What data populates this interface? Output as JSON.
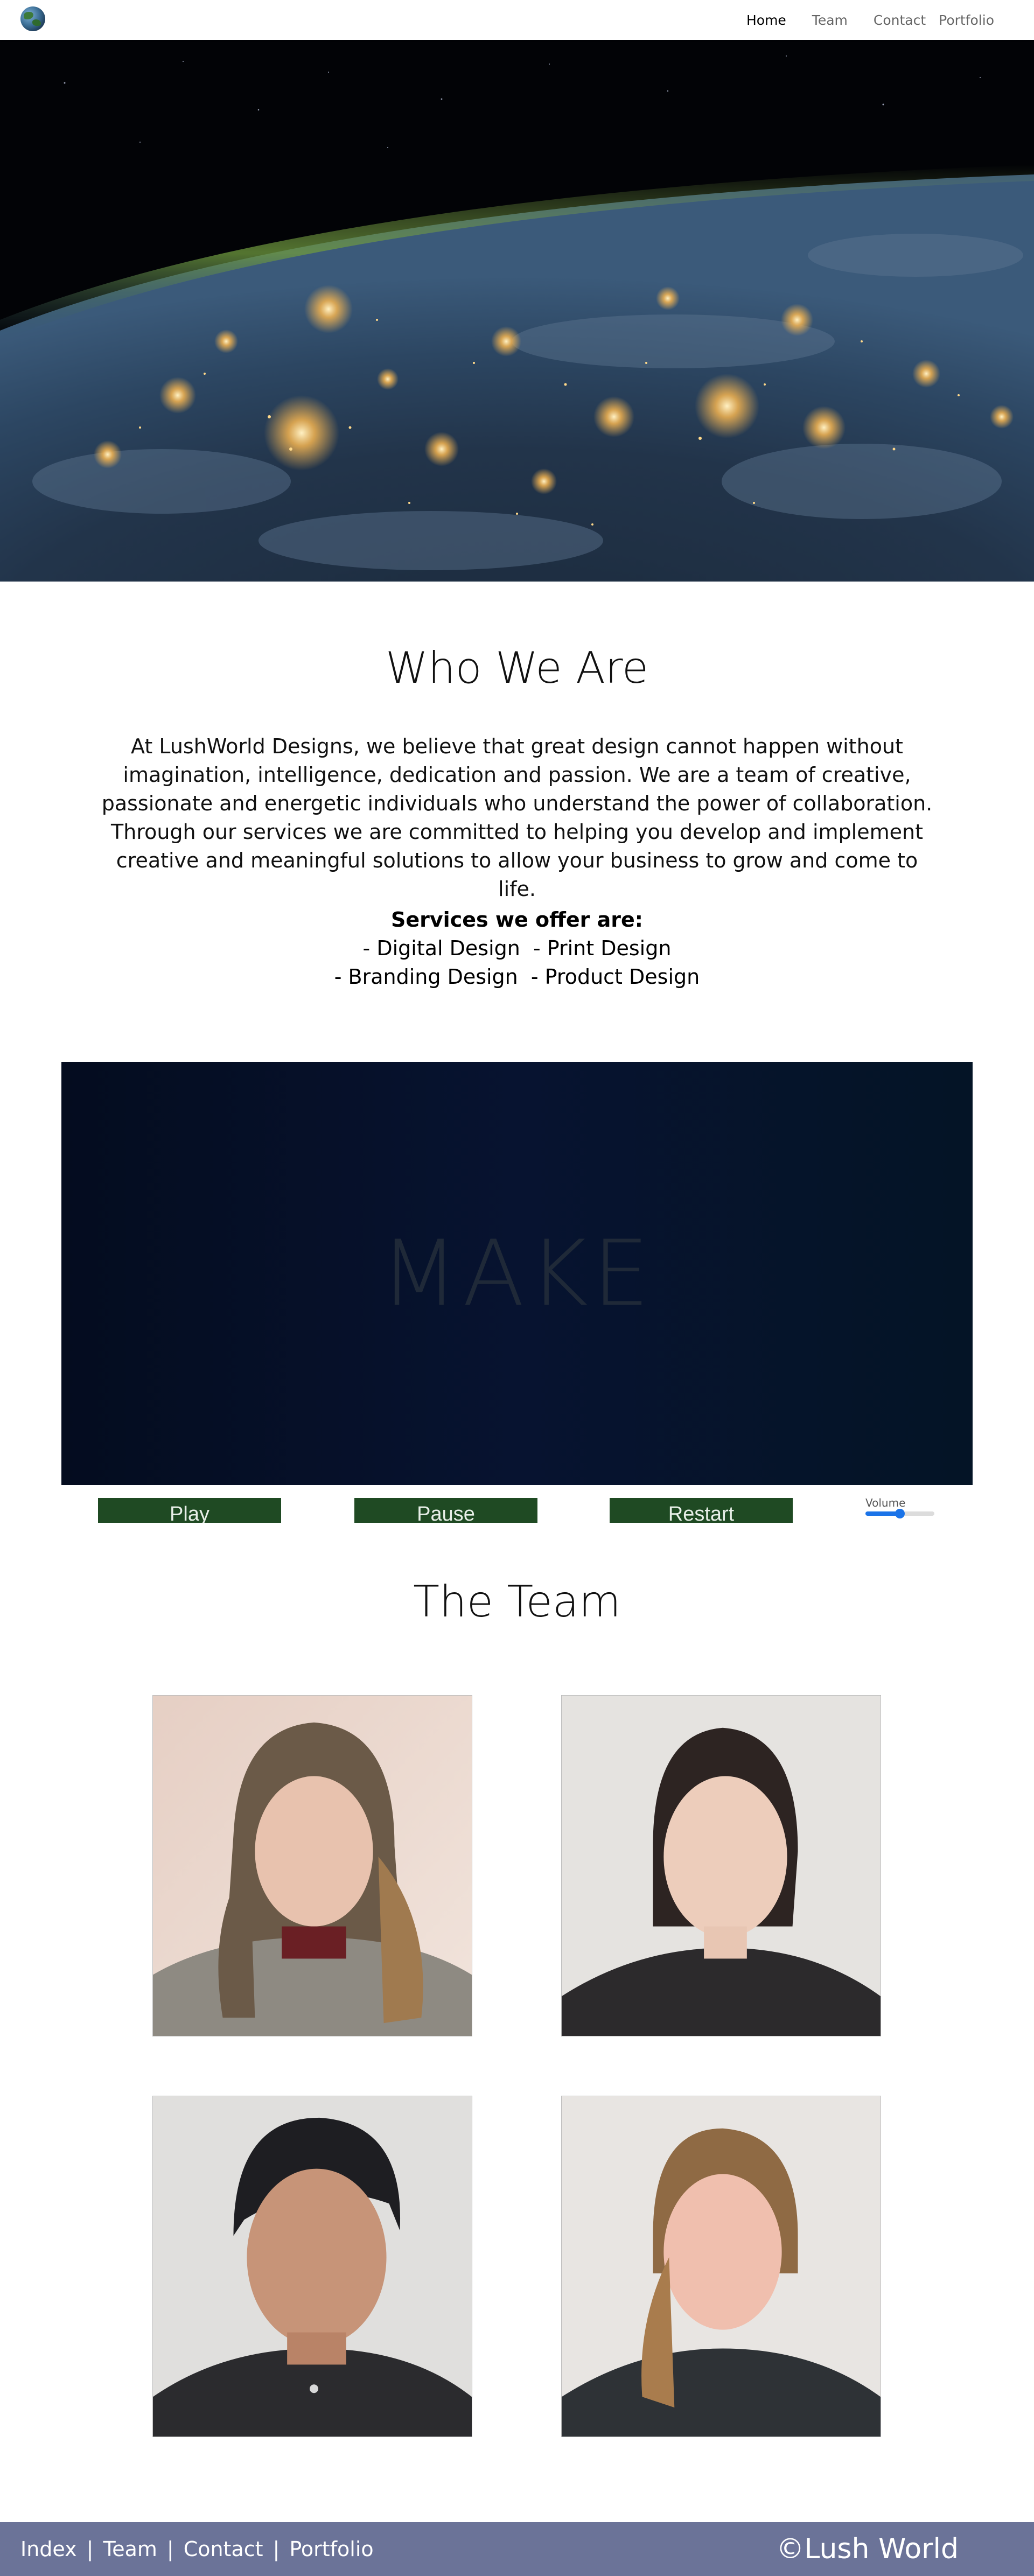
{
  "nav": {
    "logo_icon": "globe-icon",
    "links": [
      {
        "label": "Home",
        "active": true
      },
      {
        "label": "Team",
        "active": false
      },
      {
        "label": "Contact",
        "active": false
      },
      {
        "label": "Portfolio",
        "active": false
      }
    ]
  },
  "about": {
    "title": "Who We Are",
    "paragraph": "At LushWorld Designs, we believe that great design cannot happen without imagination, intelligence, dedication and passion. We are a team of creative, passionate and energetic individuals who understand the power of collaboration. Through our services we are committed to helping you develop and implement creative and meaningful solutions to allow your business to grow and come to life.",
    "services_heading": "Services we offer are:",
    "services_rows": [
      [
        "- Digital Design",
        "- Print Design"
      ],
      [
        "- Branding Design",
        "- Product Design"
      ]
    ]
  },
  "video": {
    "overlay_text": "MAKE",
    "buttons": {
      "play": "Play",
      "pause": "Pause",
      "restart": "Restart"
    },
    "volume_label": "Volume",
    "volume_level": 0.5
  },
  "team": {
    "title": "The Team"
  },
  "footer": {
    "links": [
      "Index",
      "Team",
      "Contact",
      "Portfolio"
    ],
    "separator": "|",
    "copyright": "©Lush World"
  },
  "colors": {
    "footer_bg": "#6b7398",
    "button_bg": "#1f4a23",
    "volume_accent": "#1a73e8"
  }
}
